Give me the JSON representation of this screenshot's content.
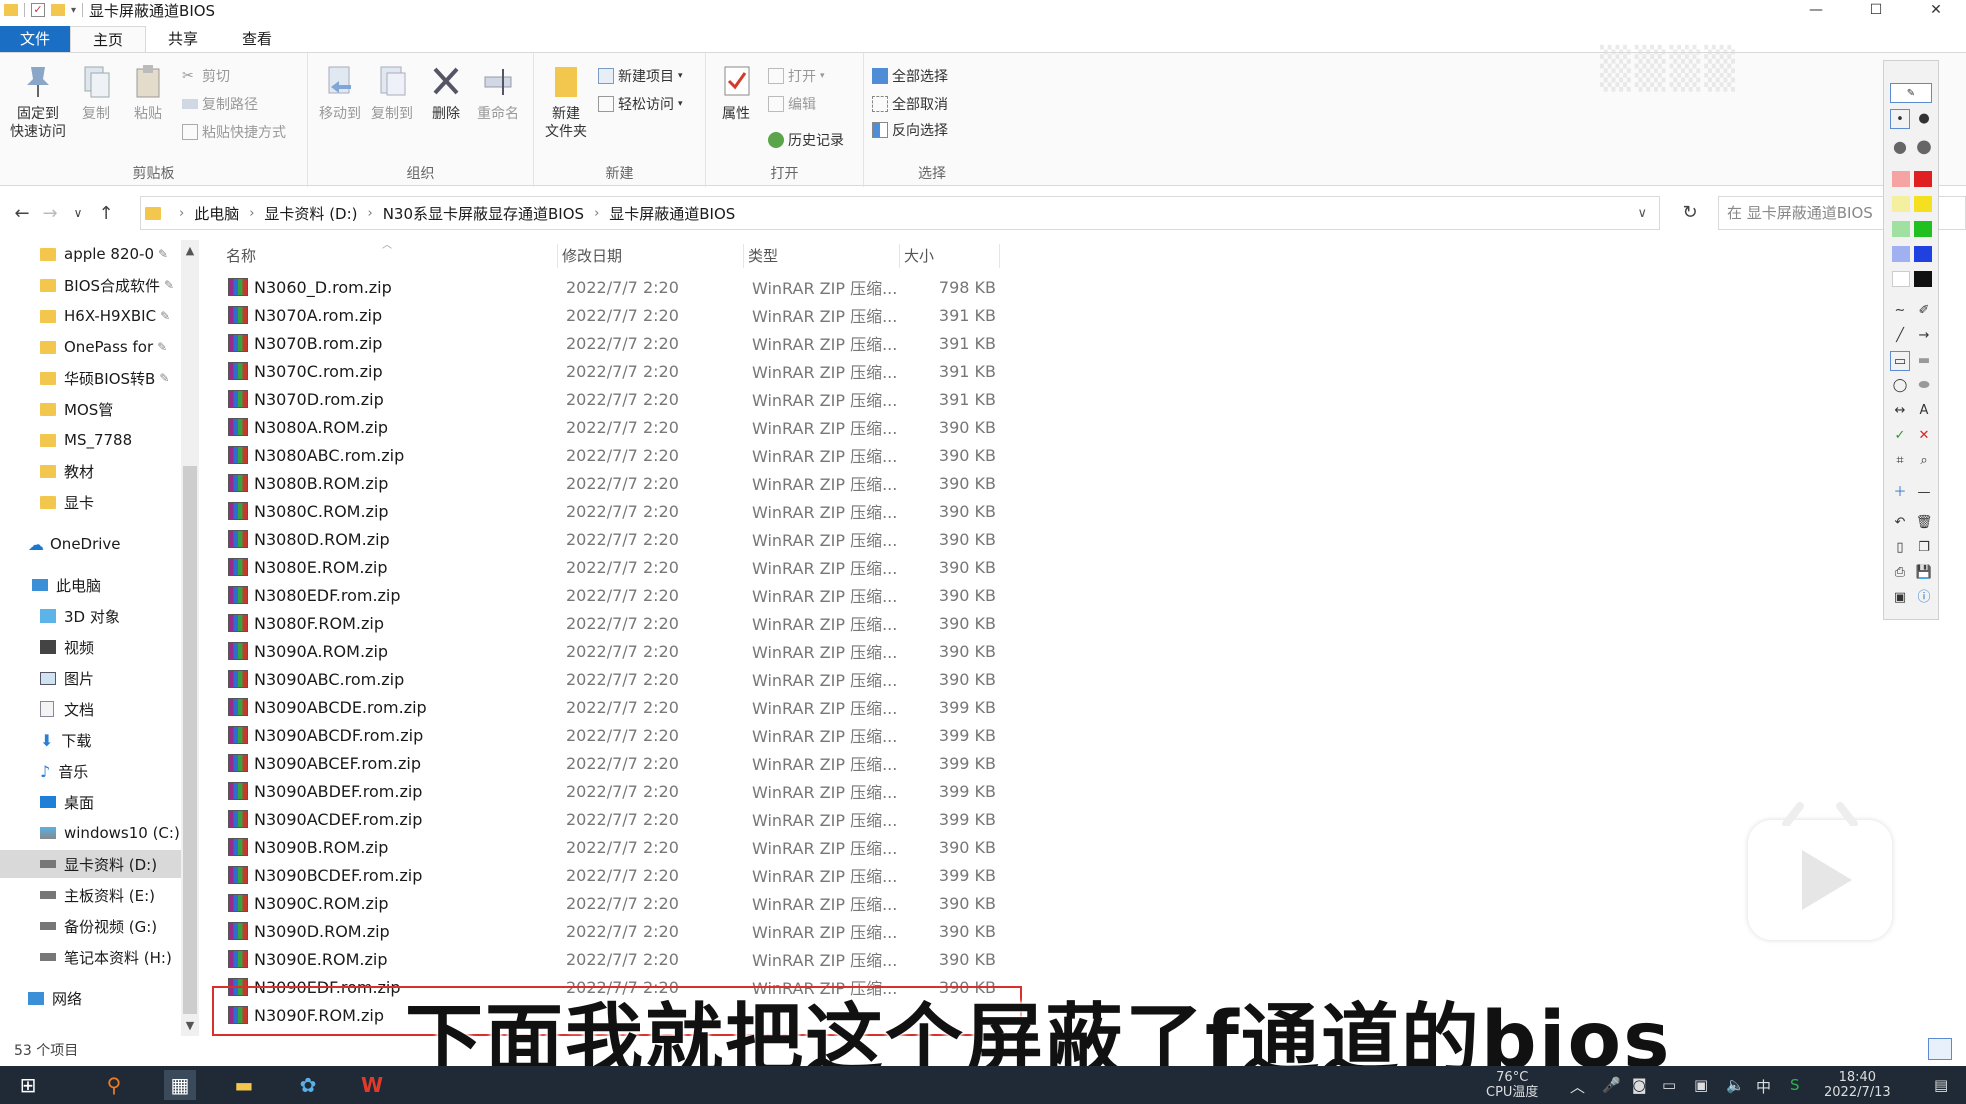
{
  "window": {
    "title": "显卡屏蔽通道BIOS",
    "controls": {
      "minimize": "—",
      "maximize": "☐",
      "close": "✕"
    }
  },
  "tabs": [
    "文件",
    "主页",
    "共享",
    "查看"
  ],
  "ribbon": {
    "clipboard": {
      "label": "剪贴板",
      "pin": "固定到\n快速访问",
      "pin_l1": "固定到",
      "pin_l2": "快速访问",
      "copy": "复制",
      "paste": "粘贴",
      "cut": "剪切",
      "copy_path": "复制路径",
      "paste_shortcut": "粘贴快捷方式"
    },
    "organize": {
      "label": "组织",
      "move_to": "移动到",
      "copy_to": "复制到",
      "delete": "删除",
      "rename": "重命名"
    },
    "new": {
      "label": "新建",
      "new_folder_l1": "新建",
      "new_folder_l2": "文件夹",
      "new_item": "新建项目",
      "easy_access": "轻松访问"
    },
    "open": {
      "label": "打开",
      "properties": "属性",
      "open": "打开",
      "edit": "编辑",
      "history": "历史记录"
    },
    "select": {
      "label": "选择",
      "select_all": "全部选择",
      "select_none": "全部取消",
      "invert": "反向选择"
    }
  },
  "address": {
    "crumbs": [
      "此电脑",
      "显卡资料 (D:)",
      "N30系显卡屏蔽显存通道BIOS",
      "显卡屏蔽通道BIOS"
    ],
    "search_placeholder": "在 显卡屏蔽通道BIOS"
  },
  "sidebar": {
    "quick": [
      "apple 820-0",
      "BIOS合成软件",
      "H6X-H9XBIC",
      "OnePass for",
      "华硕BIOS转B",
      "MOS管",
      "MS_7788",
      "教材",
      "显卡"
    ],
    "onedrive": "OneDrive",
    "this_pc": "此电脑",
    "pc_items": [
      "3D 对象",
      "视频",
      "图片",
      "文档",
      "下载",
      "音乐",
      "桌面",
      "windows10 (C:)",
      "显卡资料 (D:)",
      "主板资料 (E:)",
      "备份视频 (G:)",
      "笔记本资料 (H:)"
    ],
    "network": "网络"
  },
  "columns": {
    "name": "名称",
    "date": "修改日期",
    "type": "类型",
    "size": "大小"
  },
  "files": [
    {
      "name": "N3060_D.rom.zip",
      "date": "2022/7/7 2:20",
      "type": "WinRAR ZIP 压缩...",
      "size": "798 KB"
    },
    {
      "name": "N3070A.rom.zip",
      "date": "2022/7/7 2:20",
      "type": "WinRAR ZIP 压缩...",
      "size": "391 KB"
    },
    {
      "name": "N3070B.rom.zip",
      "date": "2022/7/7 2:20",
      "type": "WinRAR ZIP 压缩...",
      "size": "391 KB"
    },
    {
      "name": "N3070C.rom.zip",
      "date": "2022/7/7 2:20",
      "type": "WinRAR ZIP 压缩...",
      "size": "391 KB"
    },
    {
      "name": "N3070D.rom.zip",
      "date": "2022/7/7 2:20",
      "type": "WinRAR ZIP 压缩...",
      "size": "391 KB"
    },
    {
      "name": "N3080A.ROM.zip",
      "date": "2022/7/7 2:20",
      "type": "WinRAR ZIP 压缩...",
      "size": "390 KB"
    },
    {
      "name": "N3080ABC.rom.zip",
      "date": "2022/7/7 2:20",
      "type": "WinRAR ZIP 压缩...",
      "size": "390 KB"
    },
    {
      "name": "N3080B.ROM.zip",
      "date": "2022/7/7 2:20",
      "type": "WinRAR ZIP 压缩...",
      "size": "390 KB"
    },
    {
      "name": "N3080C.ROM.zip",
      "date": "2022/7/7 2:20",
      "type": "WinRAR ZIP 压缩...",
      "size": "390 KB"
    },
    {
      "name": "N3080D.ROM.zip",
      "date": "2022/7/7 2:20",
      "type": "WinRAR ZIP 压缩...",
      "size": "390 KB"
    },
    {
      "name": "N3080E.ROM.zip",
      "date": "2022/7/7 2:20",
      "type": "WinRAR ZIP 压缩...",
      "size": "390 KB"
    },
    {
      "name": "N3080EDF.rom.zip",
      "date": "2022/7/7 2:20",
      "type": "WinRAR ZIP 压缩...",
      "size": "390 KB"
    },
    {
      "name": "N3080F.ROM.zip",
      "date": "2022/7/7 2:20",
      "type": "WinRAR ZIP 压缩...",
      "size": "390 KB"
    },
    {
      "name": "N3090A.ROM.zip",
      "date": "2022/7/7 2:20",
      "type": "WinRAR ZIP 压缩...",
      "size": "390 KB"
    },
    {
      "name": "N3090ABC.rom.zip",
      "date": "2022/7/7 2:20",
      "type": "WinRAR ZIP 压缩...",
      "size": "390 KB"
    },
    {
      "name": "N3090ABCDE.rom.zip",
      "date": "2022/7/7 2:20",
      "type": "WinRAR ZIP 压缩...",
      "size": "399 KB"
    },
    {
      "name": "N3090ABCDF.rom.zip",
      "date": "2022/7/7 2:20",
      "type": "WinRAR ZIP 压缩...",
      "size": "399 KB"
    },
    {
      "name": "N3090ABCEF.rom.zip",
      "date": "2022/7/7 2:20",
      "type": "WinRAR ZIP 压缩...",
      "size": "399 KB"
    },
    {
      "name": "N3090ABDEF.rom.zip",
      "date": "2022/7/7 2:20",
      "type": "WinRAR ZIP 压缩...",
      "size": "399 KB"
    },
    {
      "name": "N3090ACDEF.rom.zip",
      "date": "2022/7/7 2:20",
      "type": "WinRAR ZIP 压缩...",
      "size": "399 KB"
    },
    {
      "name": "N3090B.ROM.zip",
      "date": "2022/7/7 2:20",
      "type": "WinRAR ZIP 压缩...",
      "size": "390 KB"
    },
    {
      "name": "N3090BCDEF.rom.zip",
      "date": "2022/7/7 2:20",
      "type": "WinRAR ZIP 压缩...",
      "size": "399 KB"
    },
    {
      "name": "N3090C.ROM.zip",
      "date": "2022/7/7 2:20",
      "type": "WinRAR ZIP 压缩...",
      "size": "390 KB"
    },
    {
      "name": "N3090D.ROM.zip",
      "date": "2022/7/7 2:20",
      "type": "WinRAR ZIP 压缩...",
      "size": "390 KB"
    },
    {
      "name": "N3090E.ROM.zip",
      "date": "2022/7/7 2:20",
      "type": "WinRAR ZIP 压缩...",
      "size": "390 KB"
    },
    {
      "name": "N3090EDF.rom.zip",
      "date": "2022/7/7 2:20",
      "type": "WinRAR ZIP 压缩...",
      "size": "390 KB"
    },
    {
      "name": "N3090F.ROM.zip",
      "date": "",
      "type": "",
      "size": ""
    }
  ],
  "status": {
    "count": "53 个项目"
  },
  "subtitle": "下面我就把这个屏蔽了f通道的bios",
  "taskbar": {
    "temp": "76°C",
    "temp_label": "CPU温度",
    "time": "18:40",
    "date": "2022/7/13",
    "ime": "中"
  },
  "colors": {
    "file_tab": "#1a6fc4",
    "highlight": "#d9302c",
    "taskbar": "#1f2a36",
    "folder": "#f3c64d"
  }
}
